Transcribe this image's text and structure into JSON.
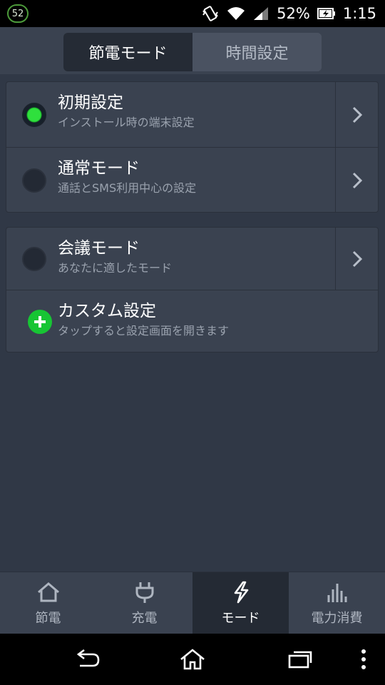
{
  "status_bar": {
    "badge": "52",
    "battery_percent": "52%",
    "time": "1:15"
  },
  "tabs": {
    "mode_label": "節電モード",
    "time_label": "時間設定"
  },
  "modes": [
    {
      "title": "初期設定",
      "subtitle": "インストール時の端末設定",
      "selected": true
    },
    {
      "title": "通常モード",
      "subtitle": "通話とSMS利用中心の設定",
      "selected": false
    },
    {
      "title": "会議モード",
      "subtitle": "あなたに適したモード",
      "selected": false
    }
  ],
  "custom": {
    "title": "カスタム設定",
    "subtitle": "タップすると設定画面を開きます"
  },
  "bottom_nav": [
    {
      "label": "節電",
      "icon": "home-icon"
    },
    {
      "label": "充電",
      "icon": "plug-icon"
    },
    {
      "label": "モード",
      "icon": "lightning-icon",
      "active": true
    },
    {
      "label": "電力消費",
      "icon": "bar-chart-icon"
    }
  ],
  "colors": {
    "background": "#303846",
    "panel": "#3a4250",
    "selected_green": "#2fe03d",
    "add_green": "#17c534"
  }
}
